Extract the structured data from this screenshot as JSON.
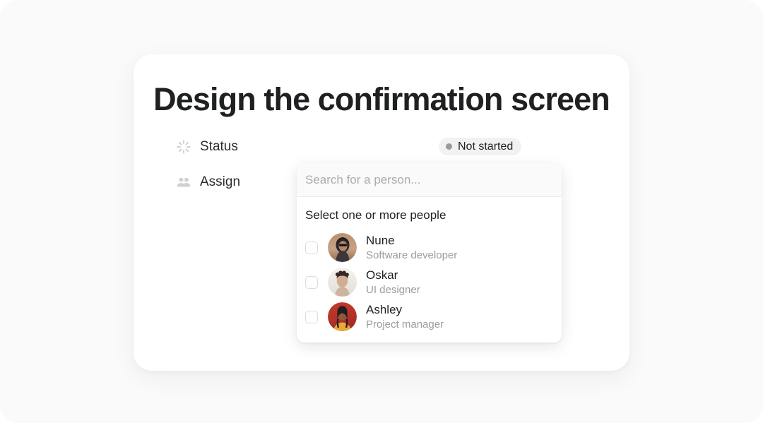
{
  "card": {
    "title": "Design the confirmation screen"
  },
  "properties": [
    {
      "icon": "spinner-icon",
      "label": "Status",
      "value": "Not started",
      "value_dot_color": "#9a9a9a",
      "value_bg_color": "#f2f2f2"
    },
    {
      "icon": "people-icon",
      "label": "Assign"
    }
  ],
  "dropdown": {
    "search": {
      "icon": "search-input",
      "placeholder": "Search for a person...",
      "value": ""
    },
    "list_header": "Select one or more people",
    "people": [
      {
        "name": "Nune",
        "role": "Software developer",
        "checked": false,
        "avatar": "avatar-photo-nune",
        "avatar_colors": [
          "#b08a6a",
          "#c6a184",
          "#3a3236",
          "#1c1a1b"
        ]
      },
      {
        "name": "Oskar",
        "role": "UI designer",
        "checked": false,
        "avatar": "avatar-photo-oskar",
        "avatar_colors": [
          "#f1eeea",
          "#e8e3dd",
          "#4a3a30",
          "#c9ab92"
        ]
      },
      {
        "name": "Ashley",
        "role": "Project manager",
        "checked": false,
        "avatar": "avatar-photo-ashley",
        "avatar_colors": [
          "#c0392b",
          "#b5332a",
          "#2a2122",
          "#e8a93c"
        ]
      }
    ]
  }
}
